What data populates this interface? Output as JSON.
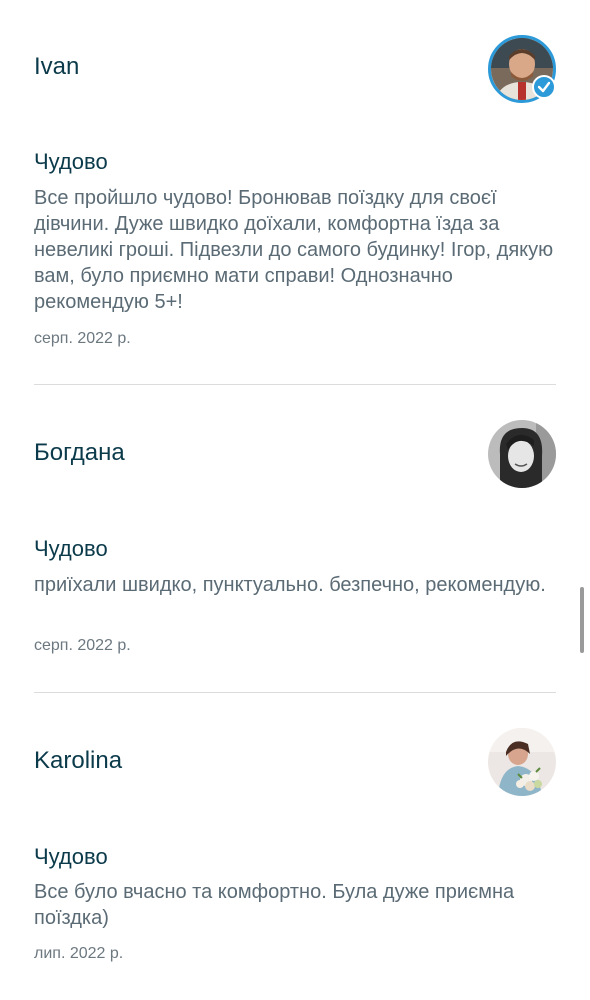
{
  "reviews": [
    {
      "name": "Ivan",
      "verified": true,
      "avatar_icon": "user-photo-man",
      "rating_label": "Чудово",
      "text": "Все пройшло чудово!  Бронював поїздку для своєї дівчини. Дуже швидко доїхали, комфортна їзда за невеликі гроші. Підвезли до самого будинку!   Ігор, дякую вам, було приємно мати справи! Однозначно рекомендую 5+!",
      "date": "серп. 2022 р."
    },
    {
      "name": "Богдана",
      "verified": false,
      "avatar_icon": "user-photo-woman-bw",
      "rating_label": "Чудово",
      "text": "приїхали швидко, пунктуально. безпечно, рекомендую.",
      "date": "серп. 2022 р."
    },
    {
      "name": "Karolina",
      "verified": false,
      "avatar_icon": "user-photo-woman-flowers",
      "rating_label": "Чудово",
      "text": "Все було вчасно та комфортно. Була дуже приємна поїздка)",
      "date": "лип. 2022 р."
    }
  ],
  "colors": {
    "heading": "#0b3a4a",
    "body_text": "#5b6b75",
    "verified_badge": "#2c9ad8",
    "divider": "#dcdcdc"
  }
}
